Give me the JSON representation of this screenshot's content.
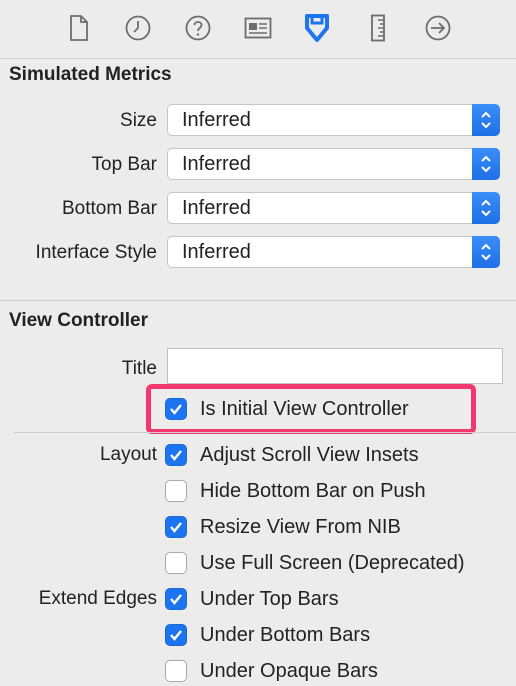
{
  "toolbar": {
    "icons": [
      "file-icon",
      "clock-icon",
      "help-icon",
      "identity-card-icon",
      "attributes-inspector-icon",
      "ruler-icon",
      "connections-arrow-icon"
    ],
    "active": "attributes-inspector-icon",
    "accent_color": "#1d74f0"
  },
  "simulated_metrics": {
    "title": "Simulated Metrics",
    "rows": [
      {
        "label": "Size",
        "value": "Inferred"
      },
      {
        "label": "Top Bar",
        "value": "Inferred"
      },
      {
        "label": "Bottom Bar",
        "value": "Inferred"
      },
      {
        "label": "Interface Style",
        "value": "Inferred"
      }
    ]
  },
  "view_controller": {
    "title": "View Controller",
    "title_field_label": "Title",
    "title_field_value": "",
    "initial_vc": {
      "label": "Is Initial View Controller",
      "checked": true
    },
    "layout_label": "Layout",
    "layout_options": [
      {
        "label": "Adjust Scroll View Insets",
        "checked": true
      },
      {
        "label": "Hide Bottom Bar on Push",
        "checked": false
      },
      {
        "label": "Resize View From NIB",
        "checked": true
      },
      {
        "label": "Use Full Screen (Deprecated)",
        "checked": false
      }
    ],
    "extend_edges_label": "Extend Edges",
    "extend_edges_options": [
      {
        "label": "Under Top Bars",
        "checked": true
      },
      {
        "label": "Under Bottom Bars",
        "checked": true
      },
      {
        "label": "Under Opaque Bars",
        "checked": false
      }
    ]
  },
  "highlight_color": "#f2386e"
}
